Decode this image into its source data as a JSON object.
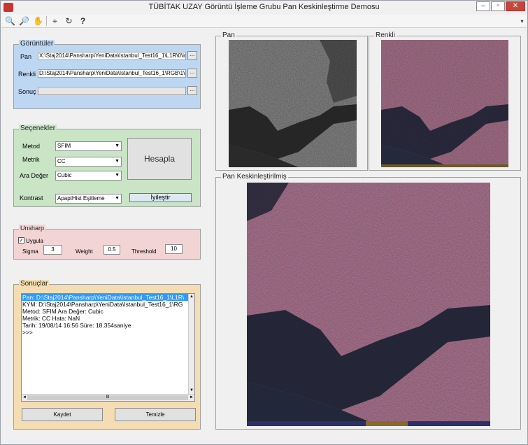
{
  "window": {
    "title": "TÜBİTAK UZAY Görüntü İşleme Grubu Pan Keskinleştirme Demosu"
  },
  "toolbar": {
    "help_label": "?"
  },
  "inputs": {
    "legend": "Görüntüler",
    "pan_label": "Pan",
    "pan_path": "X:\\Staj2014\\Pansharp\\YeniData\\Istanbul_Test16_1\\L1R\\0\\image.tif",
    "renkli_label": "Renkli",
    "renkli_path": "D:\\Staj2014\\Pansharp\\YeniData\\Istanbul_Test16_1\\RGB\\1\\image.t",
    "sonuc_label": "Sonuç",
    "sonuc_path": "",
    "browse_label": "..."
  },
  "options": {
    "legend": "Seçenekler",
    "metod_label": "Metod",
    "metod_value": "SFIM",
    "metrik_label": "Metrik",
    "metrik_value": "CC",
    "ara_deger_label": "Ara Değer",
    "ara_deger_value": "Cubic",
    "kontrast_label": "Kontrast",
    "kontrast_value": "ApaptHist Eşitleme",
    "hesapla_label": "Hesapla",
    "iyilestir_label": "İyileştir"
  },
  "unsharp": {
    "legend": "Unsharp",
    "uygula_label": "Uygula",
    "sigma_label": "Sigma",
    "sigma_value": "3",
    "weight_label": "Weight",
    "weight_value": "0.5",
    "threshold_label": "Threshold",
    "threshold_value": "10"
  },
  "results": {
    "legend": "Sonuçlar",
    "lines": [
      "Pan: D:\\Staj2014\\Pansharp\\YeniData\\Istanbul_Test16_1\\L1R\\",
      "KYM: D:\\Staj2014\\Pansharp\\YeniData\\Istanbul_Test16_1\\RG",
      "Metod: SFIM Ara Değer: Cubic",
      "Metrik: CC Hata: NaN",
      "Tarih: 19/08/14 16:56 Süre: 18.354saniye",
      ">>>"
    ],
    "scroll_thumb": "III",
    "kaydet_label": "Kaydet",
    "temizle_label": "Temizle"
  },
  "views": {
    "pan_label": "Pan",
    "renkli_label": "Renkli",
    "sharpened_label": "Pan Keskinleştirilmiş"
  }
}
